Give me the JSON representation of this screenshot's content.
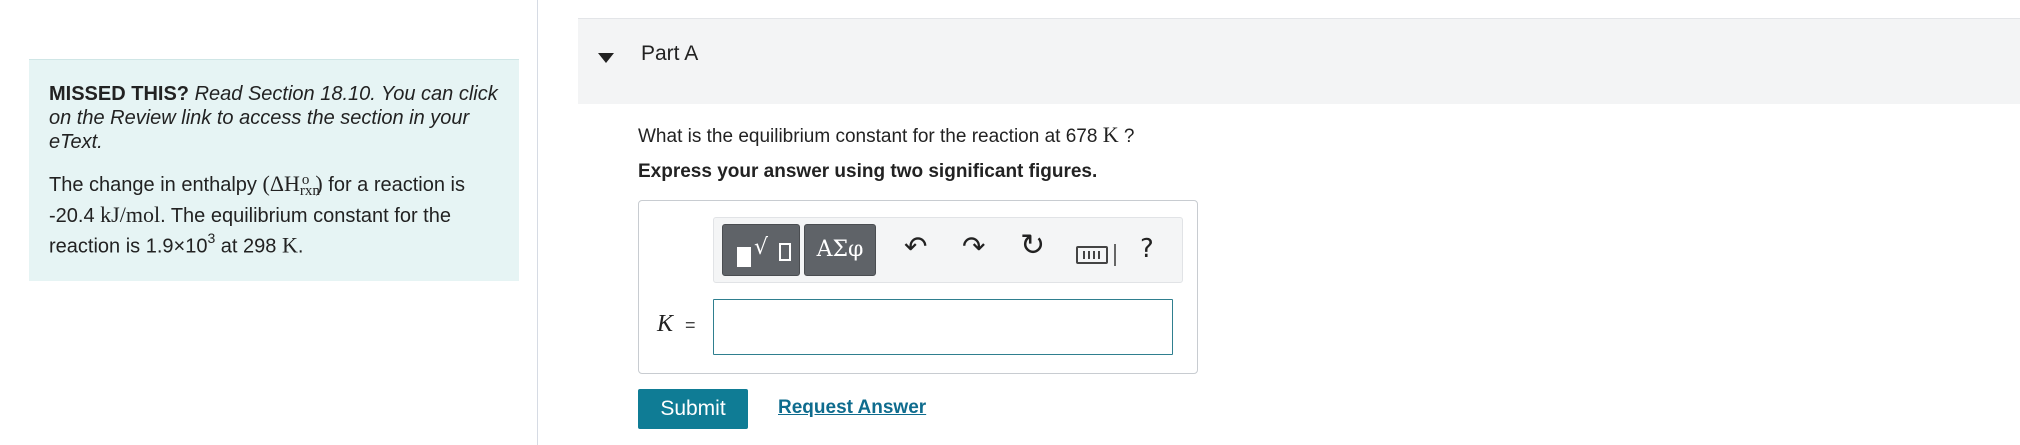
{
  "hint": {
    "missed_label": "MISSED THIS?",
    "read_text": "Read Section 18.10. You can click on the Review link to access the section in your eText.",
    "line1_pre": "The change in enthalpy",
    "enthalpy_symbol": "(ΔH",
    "enthalpy_sub": "rxn",
    "enthalpy_sup": "o",
    "enthalpy_close": ")",
    "line1_post": "for a reaction is -20.4",
    "enthalpy_units": "kJ/mol",
    "line2": ". The equilibrium constant for the reaction is 1.9×10",
    "k_exponent": "3",
    "temp_pre": "at 298",
    "temp_unit": "K",
    "temp_post": "."
  },
  "part": {
    "title": "Part A",
    "question_pre": "What is the equilibrium constant for the reaction at 678",
    "question_unit": "K",
    "question_post": "?",
    "instruction": "Express your answer using two significant figures."
  },
  "toolbar": {
    "symbols_label": "ΑΣφ",
    "undo_glyph": "↶",
    "redo_glyph": "↷",
    "reset_glyph": "↻",
    "help_glyph": "?"
  },
  "answer": {
    "variable": "K",
    "equals": "=",
    "value": ""
  },
  "actions": {
    "submit_label": "Submit",
    "request_label": "Request Answer"
  },
  "colors": {
    "hint_bg": "#e6f4f4",
    "submit_bg": "#0f7c95",
    "link": "#0f6c8e",
    "tool_button": "#5f6368"
  }
}
